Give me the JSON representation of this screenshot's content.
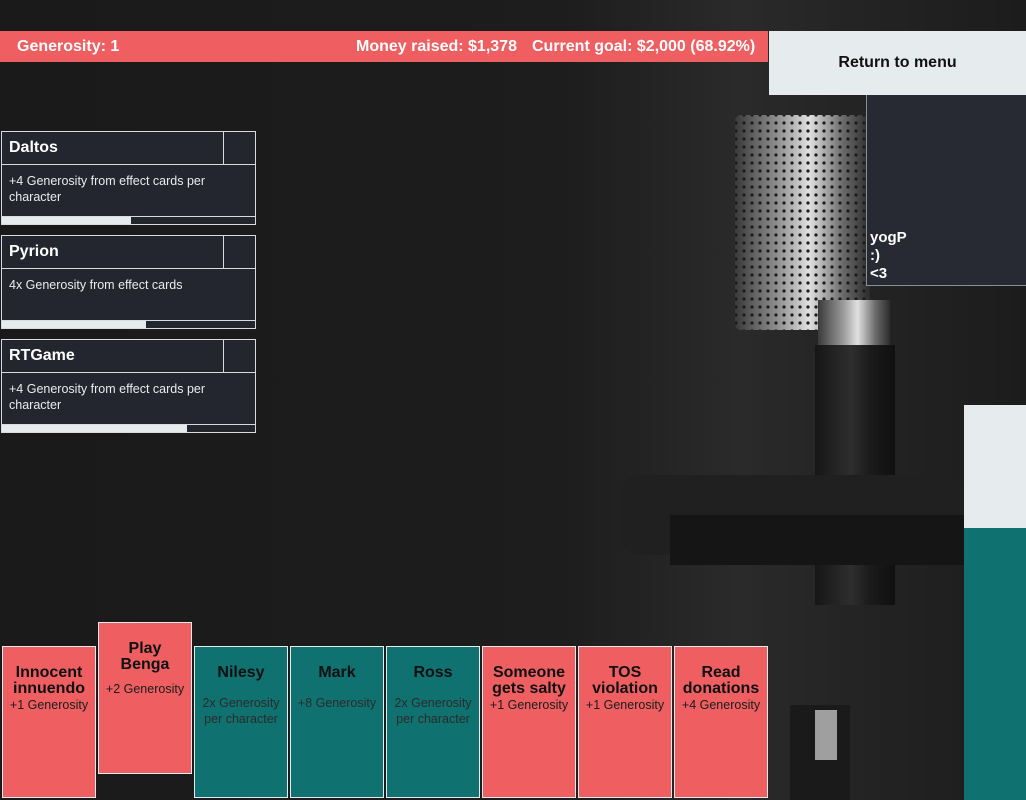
{
  "topbar": {
    "generosity": "Generosity: 1",
    "money_raised": "Money raised: $1,378",
    "current_goal": "Current goal: $2,000 (68.92%)"
  },
  "menu": {
    "return_label": "Return to menu"
  },
  "chat": {
    "lines": [
      "yogP",
      ":)",
      "<3"
    ]
  },
  "characters": [
    {
      "name": "Daltos",
      "description": "+4 Generosity from effect cards per character",
      "progress": 0.51
    },
    {
      "name": "Pyrion",
      "description": "4x Generosity from effect cards",
      "progress": 0.57
    },
    {
      "name": "RTGame",
      "description": "+4 Generosity from effect cards per character",
      "progress": 0.73
    }
  ],
  "goal_meter": {
    "fill_percent": 68.92
  },
  "hand": [
    {
      "title": "Innocent innuendo",
      "effect": "+1 Generosity",
      "color": "red",
      "raised": false
    },
    {
      "title": "Play Benga",
      "effect": "+2 Generosity",
      "color": "red",
      "raised": true
    },
    {
      "title": "Nilesy",
      "effect": "2x Generosity per character",
      "color": "teal",
      "raised": false
    },
    {
      "title": "Mark",
      "effect": "+8 Generosity",
      "color": "teal",
      "raised": false
    },
    {
      "title": "Ross",
      "effect": "2x Generosity per character",
      "color": "teal",
      "raised": false
    },
    {
      "title": "Someone gets salty",
      "effect": "+1 Generosity",
      "color": "red",
      "raised": false
    },
    {
      "title": "TOS violation",
      "effect": "+1 Generosity",
      "color": "red",
      "raised": false
    },
    {
      "title": "Read donations",
      "effect": "+4 Generosity",
      "color": "red",
      "raised": false
    }
  ],
  "colors": {
    "accent_red": "#ef5f61",
    "accent_teal": "#0f7170",
    "panel": "#23262e",
    "light": "#e6ebed"
  }
}
